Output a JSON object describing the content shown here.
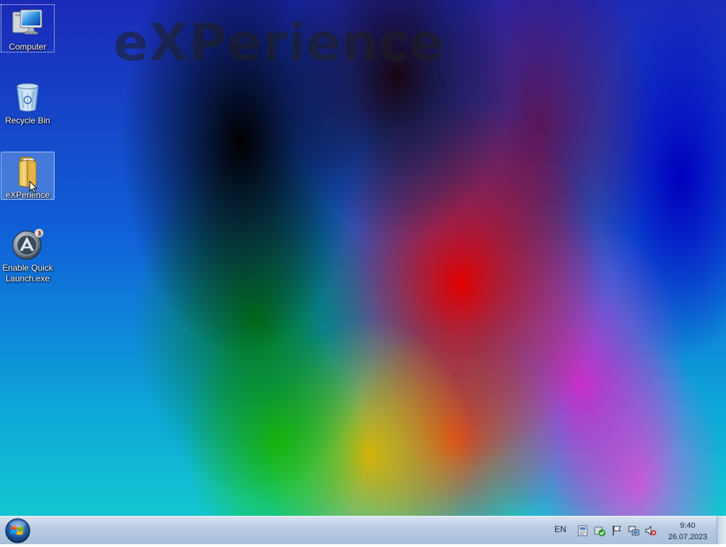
{
  "desktop": {
    "wallpaper_text": "eXPerience",
    "icons": [
      {
        "label": "Computer",
        "icon": "computer-icon"
      },
      {
        "label": "Recycle Bin",
        "icon": "recycle-bin-icon"
      },
      {
        "label": "eXPerience",
        "icon": "folder-icon"
      },
      {
        "label": "Enable Quick Launch.exe",
        "icon": "app-icon"
      }
    ]
  },
  "taskbar": {
    "start_icon": "windows-logo-icon",
    "language": "EN",
    "tray_icons": [
      "notes-icon",
      "security-check-icon",
      "action-center-flag-icon",
      "network-icon",
      "volume-muted-icon"
    ],
    "clock": {
      "time": "9:40",
      "date": "26.07.2023"
    }
  }
}
